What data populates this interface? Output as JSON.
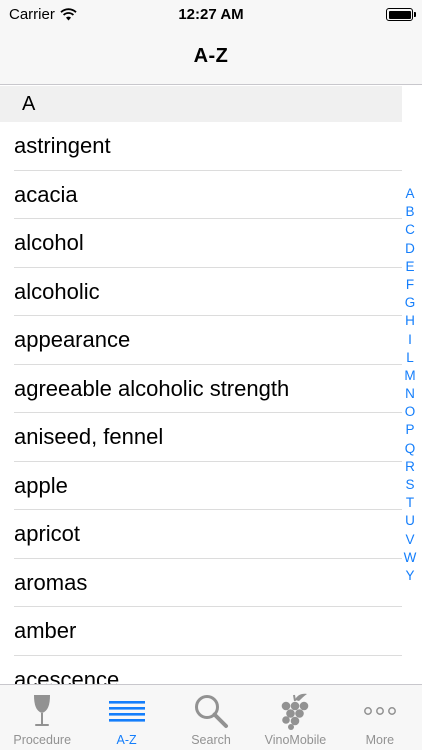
{
  "status_bar": {
    "carrier": "Carrier",
    "time": "12:27 AM",
    "wifi_icon": "wifi-icon",
    "battery_icon": "battery-icon"
  },
  "nav": {
    "title": "A-Z"
  },
  "list": {
    "section_header": "A",
    "items": [
      "astringent",
      "acacia",
      "alcohol",
      "alcoholic",
      "appearance",
      "agreeable alcoholic strength",
      "aniseed, fennel",
      "apple",
      "apricot",
      "aromas",
      "amber",
      "acescence"
    ]
  },
  "index": [
    "A",
    "B",
    "C",
    "D",
    "E",
    "F",
    "G",
    "H",
    "I",
    "L",
    "M",
    "N",
    "O",
    "P",
    "Q",
    "R",
    "S",
    "T",
    "U",
    "V",
    "W",
    "Y"
  ],
  "tabs": [
    {
      "label": "Procedure",
      "icon": "wine-glass-icon",
      "active": false
    },
    {
      "label": "A-Z",
      "icon": "list-lines-icon",
      "active": true
    },
    {
      "label": "Search",
      "icon": "magnifier-icon",
      "active": false
    },
    {
      "label": "VinoMobile",
      "icon": "grapes-icon",
      "active": false
    },
    {
      "label": "More",
      "icon": "more-dots-icon",
      "active": false
    }
  ],
  "colors": {
    "accent": "#147efb",
    "inactive": "#929292",
    "bar_background": "#f7f7f7",
    "section_background": "#f0f0f0"
  }
}
